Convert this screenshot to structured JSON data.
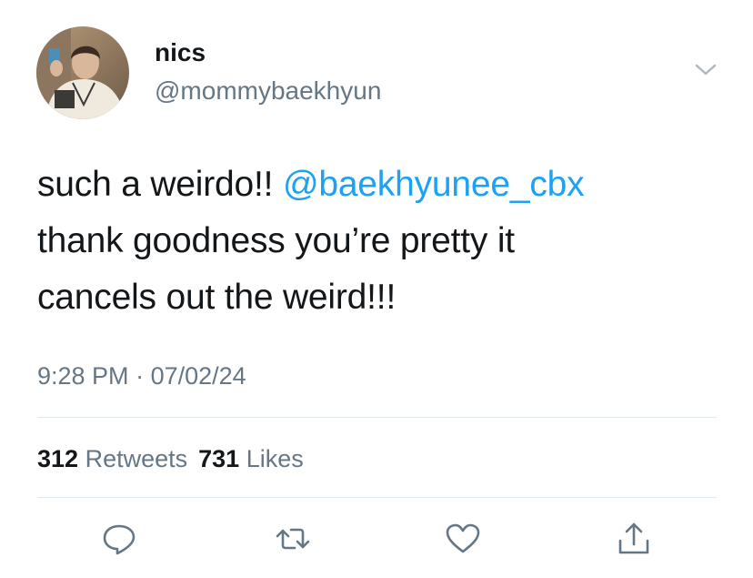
{
  "tweet": {
    "display_name": "nics",
    "handle": "@mommybaekhyun",
    "body": {
      "line1_text": "such a weirdo!! ",
      "mention": "@baekhyunee_cbx",
      "line2": "thank goodness you’re pretty it",
      "line3": "cancels out the weird!!!"
    },
    "time": "9:28 PM",
    "separator": " · ",
    "date": "07/02/24",
    "retweets_count": "312",
    "retweets_label": "Retweets",
    "likes_count": "731",
    "likes_label": "Likes"
  },
  "icons": {
    "menu": "chevron-down-icon",
    "reply": "reply-icon",
    "retweet": "retweet-icon",
    "like": "heart-icon",
    "share": "share-icon"
  },
  "colors": {
    "text": "#14171a",
    "secondary": "#657786",
    "link": "#1da1f2",
    "divider": "#e1e8ed"
  }
}
